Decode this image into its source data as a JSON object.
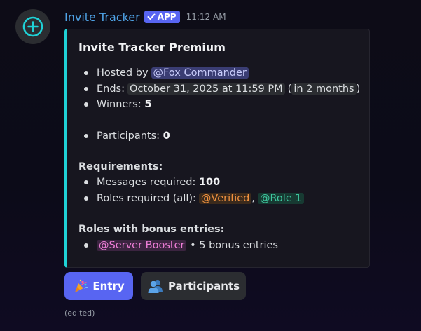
{
  "message": {
    "author": "Invite Tracker",
    "badge": "APP",
    "timestamp": "11:12 AM",
    "edited": "(edited)"
  },
  "embed": {
    "accent_color": "#1fd1d6",
    "title": "Invite Tracker Premium",
    "hosted_label": "Hosted by",
    "host_mention": "@Fox Commander",
    "ends_label": "Ends:",
    "ends_date": "October 31, 2025 at 11:59 PM",
    "ends_relative_open": "(",
    "ends_relative": "in 2 months",
    "ends_relative_close": ")",
    "winners_label": "Winners:",
    "winners_value": "5",
    "participants_label": "Participants:",
    "participants_value": "0",
    "requirements_title": "Requirements:",
    "messages_label": "Messages required:",
    "messages_value": "100",
    "roles_label": "Roles required (all):",
    "role_verified": "@Verified",
    "role_separator": ",",
    "role_1": "@Role 1",
    "bonus_title": "Roles with bonus entries:",
    "bonus_role": "@Server Booster",
    "bonus_text": "• 5 bonus entries"
  },
  "buttons": {
    "entry_label": "Entry",
    "entry_icon": "party-popper-icon",
    "participants_label": "Participants",
    "participants_icon": "busts-icon"
  },
  "colors": {
    "blurple": "#5865f2",
    "username": "#4fa3e6",
    "verified_role": "#f0913f",
    "role_1": "#3fc8a0",
    "booster_role": "#f07fd9"
  }
}
